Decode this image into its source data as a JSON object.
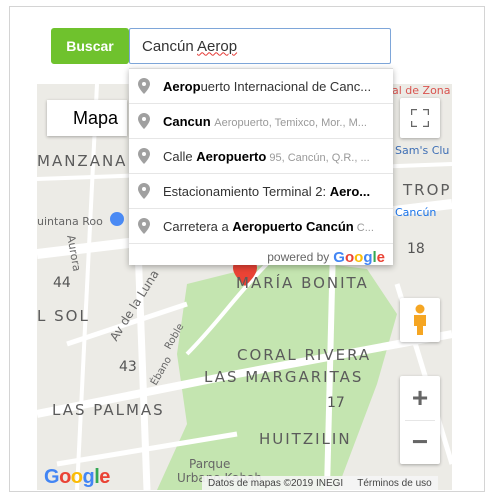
{
  "search": {
    "button_label": "Buscar",
    "query_part1": "Cancún ",
    "query_part2": "Aerop"
  },
  "map": {
    "map_type_label": "Mapa",
    "labels": {
      "zona": "al de Zona",
      "sams": "Sam's Clu",
      "manzana": "MANZANA",
      "trop": "TROP",
      "cancun_small": "Cancún",
      "quintana_roo": "uintana Roo",
      "aurora": "Aurora",
      "n18": "18",
      "n44": "44",
      "maria_bonita": "MARÍA BONITA",
      "av_luna": "Av de la Luna",
      "sol": "L SOL",
      "roble": "Roble",
      "coral_rivera": "CORAL RIVERA",
      "n43": "43",
      "margaritas": "LAS MARGARITAS",
      "ebano": "Ébano",
      "palmas": "LAS PALMAS",
      "n17": "17",
      "huitzilin": "HUITZILIN",
      "parque": "Parque",
      "urbano": "Urbano Kabah"
    },
    "footer": {
      "data_text": "Datos de mapas ©2019 INEGI",
      "terms_text": "Términos de uso"
    },
    "google_logo": "Google",
    "zoom_in": "+",
    "zoom_out": "−"
  },
  "autocomplete": {
    "items": [
      {
        "match": "Aerop",
        "rest": "uerto Internacional de Canc...",
        "secondary": ""
      },
      {
        "match": "Cancun",
        "rest": " ",
        "secondary": "Aeropuerto, Temixco, Mor., M..."
      },
      {
        "match": "Calle ",
        "rest": "Aeropuerto",
        "secondary": " 95, Cancún, Q.R., ..."
      },
      {
        "match": "Estacionamiento Terminal 2: ",
        "rest": "Aero...",
        "secondary": ""
      },
      {
        "match": "Carretera a ",
        "rest": "Aeropuerto Cancún",
        "secondary": " C..."
      }
    ],
    "powered_by": "powered by",
    "powered_brand": "Google"
  },
  "colors": {
    "accent_green": "#6fc22d",
    "input_border": "#7ea6d9",
    "park_green": "#c4e5b0",
    "marker_red": "#ea4335"
  }
}
